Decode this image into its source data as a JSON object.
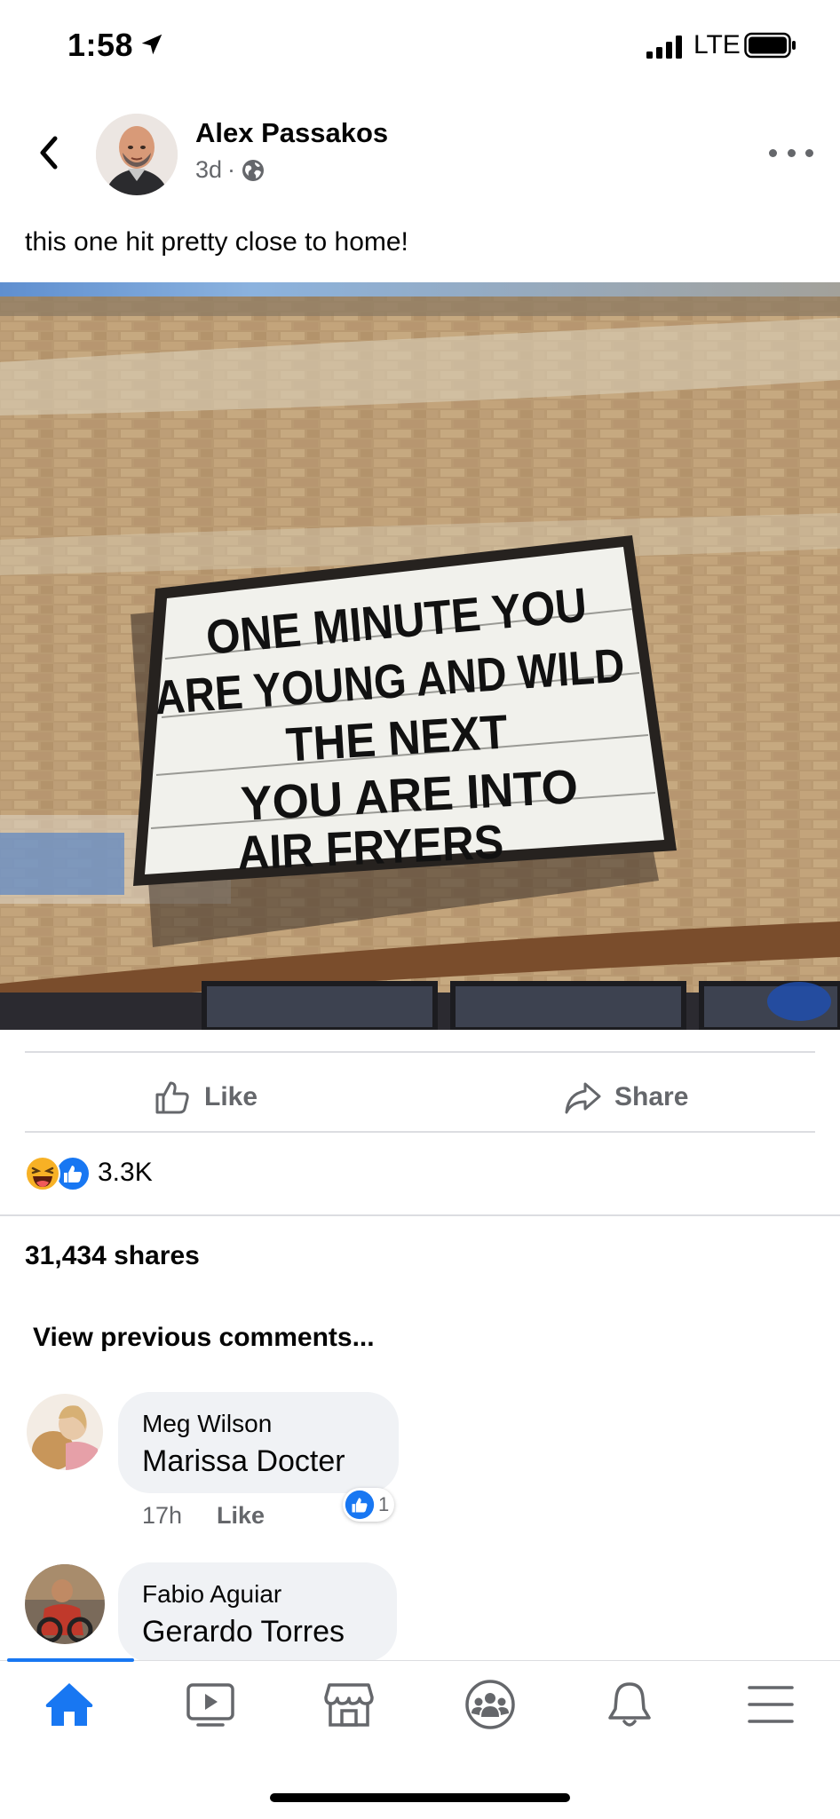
{
  "status_bar": {
    "time": "1:58",
    "network": "LTE",
    "icons": [
      "location-arrow-icon",
      "signal-bars-icon",
      "battery-icon"
    ]
  },
  "post": {
    "author": "Alex Passakos",
    "time_ago": "3d",
    "separator": "·",
    "privacy_icon": "globe-icon",
    "caption": "this one hit pretty close to home!",
    "sign_text": [
      "ONE MINUTE YOU",
      "ARE YOUNG AND WILD",
      "THE NEXT",
      "YOU ARE INTO",
      "AIR FRYERS"
    ]
  },
  "actions": {
    "like_label": "Like",
    "share_label": "Share"
  },
  "reactions": {
    "types": [
      "haha",
      "like"
    ],
    "count": "3.3K"
  },
  "shares_text": "31,434 shares",
  "view_previous": "View previous comments...",
  "comments": [
    {
      "author": "Meg Wilson",
      "text": "Marissa Docter",
      "time": "17h",
      "like_label": "Like",
      "reaction_count": "1"
    },
    {
      "author": "Fabio Aguiar",
      "text": "Gerardo Torres"
    }
  ],
  "colors": {
    "accent": "#1877f2",
    "secondary_text": "#65676b",
    "bubble": "#f0f2f5",
    "haha": "#f7b125"
  },
  "nav": {
    "items": [
      "home-icon",
      "watch-icon",
      "marketplace-icon",
      "groups-icon",
      "notifications-icon",
      "menu-icon"
    ],
    "active": "home-icon"
  }
}
